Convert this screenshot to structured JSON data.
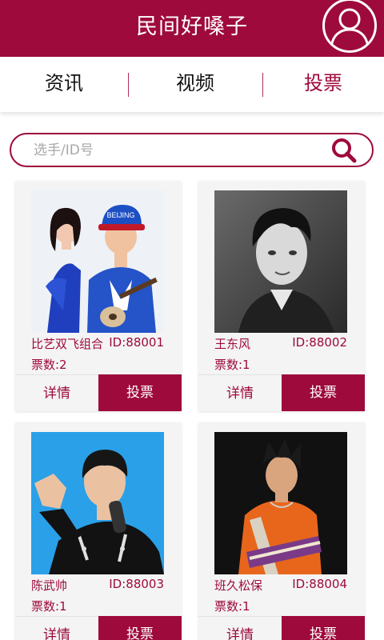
{
  "header": {
    "title": "民间好嗓子",
    "avatar_icon": "user-avatar-icon"
  },
  "tabs": [
    {
      "label": "资讯",
      "active": false
    },
    {
      "label": "视频",
      "active": false
    },
    {
      "label": "投票",
      "active": true
    }
  ],
  "search": {
    "placeholder": "选手/ID号",
    "value": "",
    "icon": "search-icon"
  },
  "colors": {
    "brand": "#9e0a3b",
    "card_bg": "#f4f4f4"
  },
  "contestants": [
    {
      "name": "比艺双飞组合",
      "id_text": "ID:88001",
      "votes_text": "票数:2",
      "detail_label": "详情",
      "vote_label": "投票",
      "cap_text": "BEIJING"
    },
    {
      "name": "王东风",
      "id_text": "ID:88002",
      "votes_text": "票数:1",
      "detail_label": "详情",
      "vote_label": "投票"
    },
    {
      "name": "陈武帅",
      "id_text": "ID:88003",
      "votes_text": "票数:1",
      "detail_label": "详情",
      "vote_label": "投票"
    },
    {
      "name": "班久松保",
      "id_text": "ID:88004",
      "votes_text": "票数:1",
      "detail_label": "详情",
      "vote_label": "投票"
    }
  ]
}
